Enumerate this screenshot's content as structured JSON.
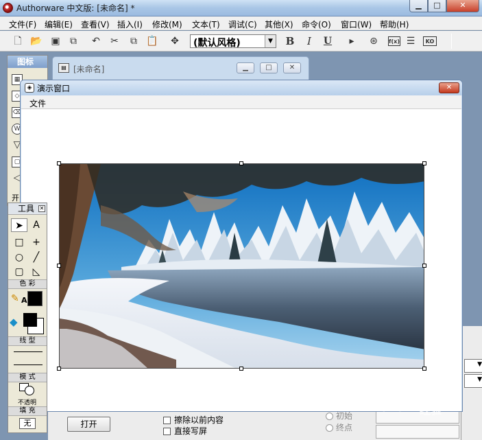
{
  "app": {
    "title": "Authorware 中文版: [未命名] *",
    "min_glyph": "▁",
    "max_glyph": "□",
    "close_glyph": "✕"
  },
  "menu": [
    {
      "label": "文件(F)"
    },
    {
      "label": "编辑(E)"
    },
    {
      "label": "查看(V)"
    },
    {
      "label": "插入(I)"
    },
    {
      "label": "修改(M)"
    },
    {
      "label": "文本(T)"
    },
    {
      "label": "调试(C)"
    },
    {
      "label": "其他(X)"
    },
    {
      "label": "命令(O)"
    },
    {
      "label": "窗口(W)"
    },
    {
      "label": "帮助(H)"
    }
  ],
  "toolbar": {
    "style_select_value": "(默认风格)",
    "bold_label": "B",
    "italic_label": "I",
    "underline_label": "U",
    "fn_label": "f(x)",
    "ko_label": "KO"
  },
  "icons_palette": {
    "title": "图标",
    "partial_label": "开"
  },
  "doc_window": {
    "title": "[未命名]"
  },
  "presentation": {
    "title": "演示窗口",
    "menu_file": "文件",
    "close_glyph": "✕"
  },
  "tools": {
    "title": "工具",
    "pointer_glyph": "➤",
    "text_glyph": "A",
    "rect_glyph": "□",
    "cross_glyph": "+",
    "ellipse_glyph": "○",
    "line_glyph": "╱",
    "roundrect_glyph": "▢",
    "polygon_glyph": "◺",
    "color_label": "色 彩",
    "linetype_label": "线 型",
    "mode_label": "模 式",
    "mode_value": "不透明",
    "fill_label": "填 充",
    "fill_value": "无"
  },
  "props": {
    "open_button": "打开",
    "erase_previous": "擦除以前内容",
    "direct_to_screen": "直接写屏",
    "radio_initial": "初始",
    "radio_end": "终点"
  },
  "watermark": {
    "brand": "Baid",
    "sub": "经验"
  },
  "colors": {
    "title_gradient_top": "#cfe2f5",
    "close_red": "#c8402a",
    "workspace": "#7e95b1",
    "palette_bg": "#ece9d8"
  }
}
